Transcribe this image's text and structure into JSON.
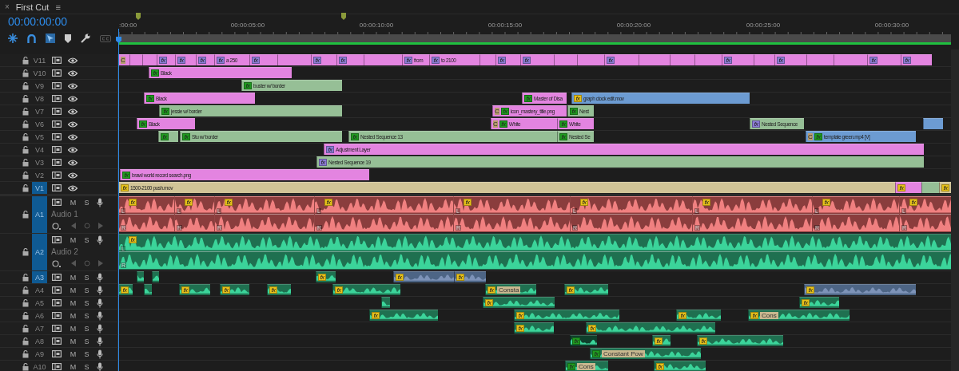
{
  "tab": {
    "close": "×",
    "title": "First Cut",
    "menu": "≡"
  },
  "timecode": "00:00:00:00",
  "ruler": {
    "labels": [
      ":00:00",
      "00:00:05:00",
      "00:00:10:00",
      "00:00:15:00",
      "00:00:20:00",
      "00:00:25:00",
      "00:00:30:00"
    ]
  },
  "video_tracks": [
    {
      "label": "V11",
      "targeted": false,
      "clips": [
        {
          "color": "#e384e0",
          "tag": "C"
        },
        {
          "color": "#e384e0"
        },
        {
          "color": "#e384e0"
        },
        {
          "color": "#e384e0",
          "badge": {
            "text": "fx",
            "color": "#8c7cd6"
          }
        },
        {
          "color": "#e384e0",
          "badge": {
            "text": "fx",
            "color": "#8c7cd6"
          }
        },
        {
          "color": "#e384e0",
          "badge": {
            "text": "fx",
            "color": "#8c7cd6"
          }
        },
        {
          "color": "#e384e0",
          "badge": {
            "text": "fx",
            "color": "#8c7cd6"
          },
          "name": "a 250"
        },
        {
          "color": "#e384e0",
          "badge": {
            "text": "fx",
            "color": "#8c7cd6"
          }
        },
        {
          "color": "#e384e0"
        },
        {
          "color": "#e384e0",
          "badge": {
            "text": "fx",
            "color": "#8c7cd6"
          }
        },
        {
          "color": "#e384e0",
          "badge": {
            "text": "fx",
            "color": "#8c7cd6"
          }
        },
        {
          "color": "#e384e0"
        },
        {
          "color": "#e384e0",
          "badge": {
            "text": "fx",
            "color": "#8c7cd6"
          },
          "name": "from"
        },
        {
          "color": "#e384e0",
          "badge": {
            "text": "fx",
            "color": "#8c7cd6"
          },
          "name": "to 2100"
        },
        {
          "color": "#e384e0"
        },
        {
          "color": "#e384e0",
          "badge": {
            "text": "fx",
            "color": "#8c7cd6"
          }
        },
        {
          "color": "#e384e0",
          "badge": {
            "text": "fx",
            "color": "#8c7cd6"
          }
        },
        {
          "color": "#e384e0"
        },
        {
          "color": "#e384e0"
        },
        {
          "color": "#e384e0",
          "badge": {
            "text": "fx",
            "color": "#8c7cd6"
          }
        },
        {
          "color": "#e384e0"
        },
        {
          "color": "#e384e0"
        },
        {
          "color": "#e384e0"
        },
        {
          "color": "#e384e0",
          "badge": {
            "text": "fx",
            "color": "#8c7cd6"
          }
        },
        {
          "color": "#e384e0"
        },
        {
          "color": "#e384e0",
          "badge": {
            "text": "fx",
            "color": "#8c7cd6"
          }
        },
        {
          "color": "#e384e0"
        },
        {
          "color": "#e384e0"
        },
        {
          "color": "#e384e0",
          "badge": {
            "text": "fx",
            "color": "#8c7cd6"
          }
        },
        {
          "color": "#e384e0",
          "badge": {
            "text": "fx",
            "color": "#8c7cd6"
          }
        }
      ]
    },
    {
      "label": "V10",
      "targeted": false,
      "clips": [
        {
          "color": "#e384e0",
          "badge": {
            "text": "fx",
            "color": "#1f9a1f"
          },
          "name": "Black"
        }
      ]
    },
    {
      "label": "V9",
      "targeted": false,
      "clips": [
        {
          "color": "#96bf96",
          "badge": {
            "text": "fx",
            "color": "#1f9a1f"
          },
          "name": "buster w/ border"
        }
      ]
    },
    {
      "label": "V8",
      "targeted": false,
      "clips": [
        {
          "color": "#e384e0",
          "badge": {
            "text": "fx",
            "color": "#1f9a1f"
          },
          "name": "Black"
        },
        {
          "color": "#e384e0",
          "badge": {
            "text": "fx",
            "color": "#1f9a1f"
          },
          "name": "Master of Disa"
        },
        {
          "color": "#6c9bd2",
          "badge": {
            "text": "fx",
            "color": "#e8c21a"
          },
          "name": "graph clock edit.mov"
        }
      ]
    },
    {
      "label": "V7",
      "targeted": false,
      "clips": [
        {
          "color": "#96bf96",
          "badge": {
            "text": "fx",
            "color": "#1f9a1f"
          },
          "name": "jessie w/ border"
        },
        {
          "color": "#e384e0",
          "tag": "C",
          "badge": {
            "text": "fx",
            "color": "#1f9a1f"
          },
          "name": "icon_mastery_title.png"
        },
        {
          "color": "#96bf96",
          "badge": {
            "text": "fx",
            "color": "#1f9a1f"
          },
          "name": "Nest"
        }
      ]
    },
    {
      "label": "V6",
      "targeted": false,
      "clips": [
        {
          "color": "#e384e0",
          "badge": {
            "text": "fx",
            "color": "#1f9a1f"
          },
          "name": "Black"
        },
        {
          "color": "#e384e0",
          "tag": "C",
          "badge": {
            "text": "fx",
            "color": "#1f9a1f"
          },
          "name": "White"
        },
        {
          "color": "#e384e0",
          "badge": {
            "text": "fx",
            "color": "#1f9a1f"
          },
          "name": "White"
        },
        {
          "color": "#96bf96",
          "badge": {
            "text": "fx",
            "color": "#8c7cd6"
          },
          "name": "Nested Sequence"
        },
        {
          "color": "#6c9bd2"
        }
      ]
    },
    {
      "label": "V5",
      "targeted": false,
      "clips": [
        {
          "color": "#96bf96",
          "badge": {
            "text": "fx",
            "color": "#1f9a1f"
          }
        },
        {
          "color": "#96bf96",
          "badge": {
            "text": "fx",
            "color": "#1f9a1f"
          },
          "name": "Stu w/ border"
        },
        {
          "color": "#96bf96",
          "badge": {
            "text": "fx",
            "color": "#1f9a1f"
          },
          "name": "Nested Sequence 13"
        },
        {
          "color": "#96bf96",
          "badge": {
            "text": "fx",
            "color": "#1f9a1f"
          },
          "name": "Nested Se"
        },
        {
          "color": "#6c9bd2",
          "tag": "C",
          "badge": {
            "text": "fx",
            "color": "#1f9a1f"
          },
          "name": "template green.mp4 [V]"
        }
      ]
    },
    {
      "label": "V4",
      "targeted": false,
      "clips": [
        {
          "color": "#e384e0",
          "badge": {
            "text": "fx",
            "color": "#8c7cd6"
          },
          "name": "Adjustment Layer"
        }
      ]
    },
    {
      "label": "V3",
      "targeted": false,
      "clips": [
        {
          "color": "#96bf96",
          "badge": {
            "text": "fx",
            "color": "#8c7cd6"
          },
          "name": "Nested Sequence 19"
        }
      ]
    },
    {
      "label": "V2",
      "targeted": false,
      "clips": [
        {
          "color": "#e384e0",
          "badge": {
            "text": "fx",
            "color": "#1f9a1f"
          },
          "name": "brawl world record search.png"
        }
      ]
    },
    {
      "label": "V1",
      "targeted": true,
      "clips": [
        {
          "color": "#d1c497",
          "badge": {
            "text": "fx",
            "color": "#e8c21a"
          },
          "name": "1500-2100 push.mov"
        },
        {
          "color": "#e384e0",
          "badge": {
            "text": "fx",
            "color": "#e8c21a"
          }
        },
        {
          "color": "#96bf96"
        },
        {
          "color": "#d1c497",
          "badge": {
            "text": "fx",
            "color": "#e8c21a"
          }
        }
      ]
    }
  ],
  "audio_tracks": [
    {
      "label": "A1",
      "targeted": true,
      "name": "Audio 1",
      "mute": "M",
      "solo": "S",
      "clips": [
        {
          "color": "#e06b6b",
          "badge": {
            "text": "fx",
            "color": "#e8c21a"
          },
          "channels": [
            "L",
            "R"
          ]
        },
        {
          "color": "#e06b6b",
          "badge": {
            "text": "fx",
            "color": "#e8c21a"
          },
          "channels": [
            "L",
            "R"
          ]
        },
        {
          "color": "#e06b6b",
          "badge": {
            "text": "fx",
            "color": "#e8c21a"
          },
          "channels": [
            "L",
            "R"
          ]
        },
        {
          "color": "#e06b6b",
          "badge": {
            "text": "fx",
            "color": "#e8c21a"
          },
          "channels": [
            "L",
            "R"
          ]
        },
        {
          "color": "#e06b6b",
          "badge": {
            "text": "fx",
            "color": "#e8c21a"
          },
          "channels": [
            "L",
            "R"
          ]
        },
        {
          "color": "#e06b6b",
          "badge": {
            "text": "fx",
            "color": "#e8c21a"
          },
          "channels": [
            "L",
            "R"
          ]
        },
        {
          "color": "#e06b6b",
          "badge": {
            "text": "fx",
            "color": "#e8c21a"
          },
          "channels": [
            "L",
            "R"
          ]
        },
        {
          "color": "#e06b6b",
          "badge": {
            "text": "fx",
            "color": "#e8c21a"
          },
          "channels": [
            "L",
            "R"
          ]
        },
        {
          "color": "#e06b6b",
          "badge": {
            "text": "fx",
            "color": "#e8c21a"
          },
          "channels": [
            "L",
            "R"
          ]
        }
      ]
    },
    {
      "label": "A2",
      "targeted": true,
      "name": "Audio 2",
      "mute": "M",
      "solo": "S",
      "clips": [
        {
          "color": "#1f7050",
          "badge": {
            "text": "fx",
            "color": "#e8c21a"
          },
          "channels": [
            "L",
            "R"
          ]
        }
      ]
    },
    {
      "label": "A3",
      "targeted": true,
      "mute": "M",
      "solo": "S",
      "clips": [
        {
          "color": "#1f7050"
        },
        {
          "color": "#1f7050"
        },
        {
          "color": "#1f7050",
          "badge": {
            "text": "fx",
            "color": "#e8c21a"
          }
        },
        {
          "color": "#4d6585",
          "badge": {
            "text": "fx",
            "color": "#e8c21a"
          }
        },
        {
          "color": "#4d6585",
          "badge": {
            "text": "fx",
            "color": "#e8c21a"
          }
        }
      ]
    },
    {
      "label": "A4",
      "targeted": false,
      "mute": "M",
      "solo": "S",
      "clips": [
        {
          "color": "#1f7050",
          "badge": {
            "text": "fx",
            "color": "#e8c21a"
          }
        },
        {
          "color": "#1f7050"
        },
        {
          "color": "#1f7050",
          "badge": {
            "text": "fx",
            "color": "#e8c21a"
          }
        },
        {
          "color": "#1f7050",
          "badge": {
            "text": "fx",
            "color": "#e8c21a"
          }
        },
        {
          "color": "#1f7050",
          "badge": {
            "text": "fx",
            "color": "#e8c21a"
          }
        },
        {
          "color": "#1f7050",
          "badge": {
            "text": "fx",
            "color": "#e8c21a"
          }
        },
        {
          "color": "#1f7050",
          "badge": {
            "text": "fx",
            "color": "#e8c21a"
          },
          "label": "Consta"
        },
        {
          "color": "#1f7050",
          "badge": {
            "text": "fx",
            "color": "#e8c21a"
          }
        },
        {
          "color": "#4d6585",
          "badge": {
            "text": "fx",
            "color": "#e8c21a"
          }
        }
      ]
    },
    {
      "label": "A5",
      "targeted": false,
      "mute": "M",
      "solo": "S",
      "clips": [
        {
          "color": "#1f7050"
        },
        {
          "color": "#1f7050",
          "badge": {
            "text": "fx",
            "color": "#e8c21a"
          }
        },
        {
          "color": "#1f7050",
          "badge": {
            "text": "fx",
            "color": "#e8c21a"
          }
        }
      ]
    },
    {
      "label": "A6",
      "targeted": false,
      "mute": "M",
      "solo": "S",
      "clips": [
        {
          "color": "#1f7050",
          "badge": {
            "text": "fx",
            "color": "#e8c21a"
          }
        },
        {
          "color": "#1f7050",
          "badge": {
            "text": "fx",
            "color": "#e8c21a"
          }
        },
        {
          "color": "#1f7050",
          "badge": {
            "text": "fx",
            "color": "#e8c21a"
          }
        },
        {
          "color": "#1f7050",
          "badge": {
            "text": "fx",
            "color": "#e8c21a"
          },
          "label": "Cons"
        }
      ]
    },
    {
      "label": "A7",
      "targeted": false,
      "mute": "M",
      "solo": "S",
      "clips": [
        {
          "color": "#1f7050",
          "badge": {
            "text": "fx",
            "color": "#e8c21a"
          }
        },
        {
          "color": "#1f7050",
          "badge": {
            "text": "fx",
            "color": "#e8c21a"
          }
        }
      ]
    },
    {
      "label": "A8",
      "targeted": false,
      "mute": "M",
      "solo": "S",
      "clips": [
        {
          "color": "#0f3f2c",
          "badge": {
            "text": "fx",
            "color": "#1f9a1f"
          }
        },
        {
          "color": "#1f7050",
          "badge": {
            "text": "fx",
            "color": "#e8c21a"
          }
        },
        {
          "color": "#1f7050",
          "badge": {
            "text": "fx",
            "color": "#e8c21a"
          }
        }
      ]
    },
    {
      "label": "A9",
      "targeted": false,
      "mute": "M",
      "solo": "S",
      "clips": [
        {
          "color": "#1f7050",
          "badge": {
            "text": "fx",
            "color": "#1f9a1f"
          },
          "label": "Constant Pow"
        }
      ]
    },
    {
      "label": "A10",
      "targeted": false,
      "mute": "M",
      "solo": "S",
      "clips": [
        {
          "color": "#1f7050",
          "badge": {
            "text": "fx",
            "color": "#1f9a1f"
          },
          "label": "Cons"
        },
        {
          "color": "#1f7050",
          "badge": {
            "text": "fx",
            "color": "#e8c21a"
          }
        }
      ]
    }
  ]
}
